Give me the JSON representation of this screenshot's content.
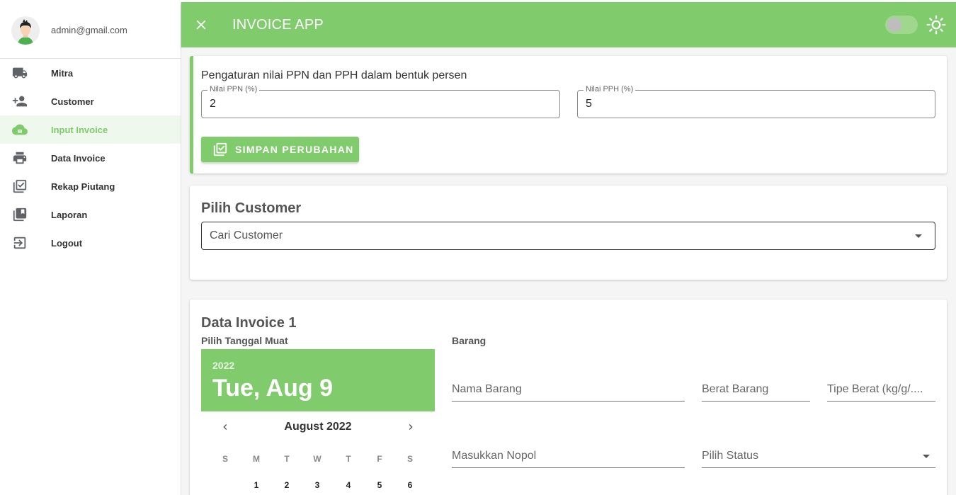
{
  "sidebar": {
    "user_email": "admin@gmail.com",
    "items": [
      {
        "label": "Mitra",
        "icon": "truck-icon"
      },
      {
        "label": "Customer",
        "icon": "person-add-icon"
      },
      {
        "label": "Input Invoice",
        "icon": "cloud-upload-icon",
        "active": true
      },
      {
        "label": "Data Invoice",
        "icon": "printer-icon"
      },
      {
        "label": "Rekap Piutang",
        "icon": "checklist-icon"
      },
      {
        "label": "Laporan",
        "icon": "library-books-icon"
      },
      {
        "label": "Logout",
        "icon": "logout-icon"
      }
    ]
  },
  "topbar": {
    "title": "INVOICE APP",
    "theme_toggle_on": false
  },
  "tax_settings": {
    "heading": "Pengaturan nilai PPN dan PPH dalam bentuk persen",
    "ppn_label": "Nilai PPN (%)",
    "ppn_value": "2",
    "pph_label": "Nilai PPH (%)",
    "pph_value": "5",
    "save_label": "SIMPAN PERUBAHAN"
  },
  "customer": {
    "title": "Pilih Customer",
    "placeholder": "Cari Customer"
  },
  "invoice": {
    "title": "Data Invoice 1",
    "date_label": "Pilih Tanggal Muat",
    "picker": {
      "year": "2022",
      "selected": "Tue, Aug 9",
      "month": "August 2022",
      "weekdays": [
        "S",
        "M",
        "T",
        "W",
        "T",
        "F",
        "S"
      ],
      "days": [
        "1",
        "2",
        "3",
        "4",
        "5",
        "6"
      ]
    },
    "barang_label": "Barang",
    "nama_barang": "Nama Barang",
    "berat_barang": "Berat Barang",
    "tipe_berat": "Tipe Berat (kg/g/....",
    "nopol": "Masukkan Nopol",
    "status": "Pilih Status"
  },
  "colors": {
    "accent": "#80cb6c",
    "active_bg": "#eef8ec"
  }
}
